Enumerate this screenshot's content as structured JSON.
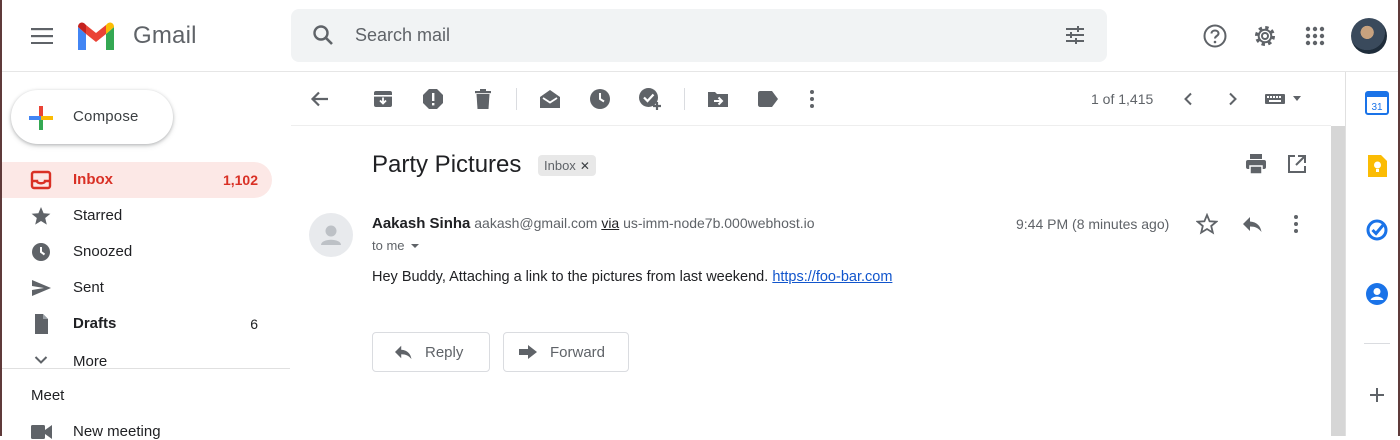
{
  "header": {
    "app_name": "Gmail",
    "search_placeholder": "Search mail"
  },
  "compose": {
    "label": "Compose"
  },
  "nav": {
    "items": [
      {
        "label": "Inbox",
        "count": "1,102",
        "icon": "inbox-icon",
        "active": true
      },
      {
        "label": "Starred",
        "count": "",
        "icon": "star-icon"
      },
      {
        "label": "Snoozed",
        "count": "",
        "icon": "clock-icon"
      },
      {
        "label": "Sent",
        "count": "",
        "icon": "send-icon"
      },
      {
        "label": "Drafts",
        "count": "6",
        "icon": "draft-icon"
      },
      {
        "label": "More",
        "count": "",
        "icon": "chevron-down-icon"
      }
    ],
    "meet_title": "Meet",
    "meet_items": [
      {
        "label": "New meeting",
        "icon": "video-camera-icon"
      }
    ]
  },
  "toolbar": {
    "pager": "1 of 1,415"
  },
  "message": {
    "subject": "Party Pictures",
    "label_chip": "Inbox",
    "sender_name": "Aakash Sinha",
    "sender_email": "aakash@gmail.com",
    "via_word": "via",
    "via_host": "us-imm-node7b.000webhost.io",
    "recipient": "to me",
    "time": "9:44 PM (8 minutes ago)",
    "body_text": "Hey Buddy, Attaching a link to the pictures from last weekend.",
    "body_link": "https://foo-bar.com",
    "reply_label": "Reply",
    "forward_label": "Forward"
  },
  "side_panel": {
    "calendar_date": "31",
    "colors": {
      "calendar": "#1a73e8",
      "keep": "#fbbc04",
      "tasks": "#1a73e8",
      "contacts": "#1a73e8"
    }
  },
  "colors": {
    "accent_red": "#d93025",
    "active_bg": "#fce8e6",
    "link": "#1155cc"
  }
}
